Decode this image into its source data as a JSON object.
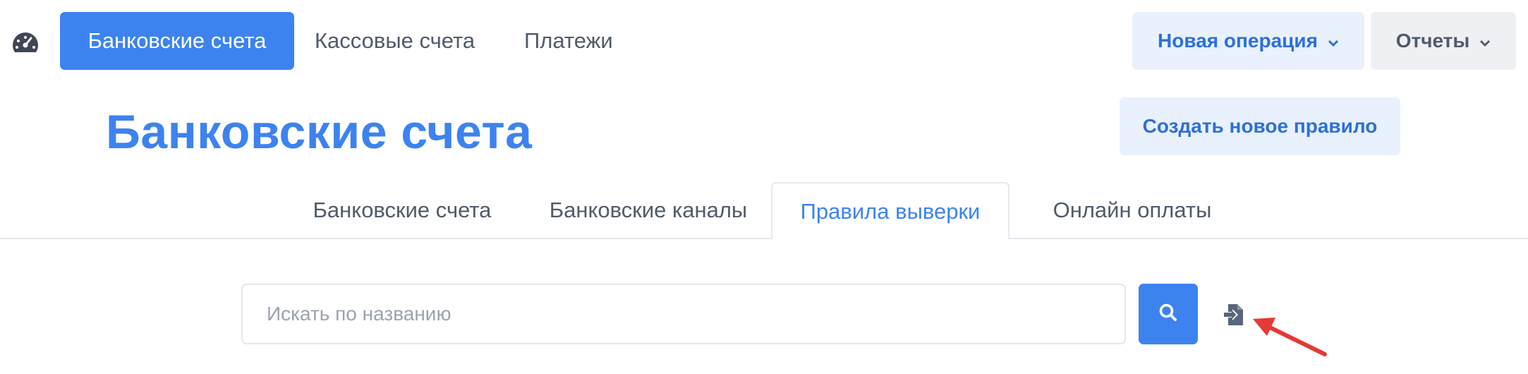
{
  "nav": {
    "dashboard_icon": "speedometer-icon",
    "items": [
      {
        "label": "Банковские счета",
        "active": true
      },
      {
        "label": "Кассовые счета",
        "active": false
      },
      {
        "label": "Платежи",
        "active": false
      }
    ],
    "new_operation_label": "Новая операция",
    "reports_label": "Отчеты"
  },
  "header": {
    "title": "Банковские счета",
    "create_rule_label": "Создать новое правило"
  },
  "tabs": [
    {
      "label": "Банковские счета",
      "active": false
    },
    {
      "label": "Банковские каналы",
      "active": false
    },
    {
      "label": "Правила выверки",
      "active": true
    },
    {
      "label": "Онлайн оплаты",
      "active": false
    }
  ],
  "search": {
    "placeholder": "Искать по названию",
    "value": ""
  },
  "icons": {
    "search": "magnifier-icon",
    "import": "file-import-icon",
    "annotation": "red-arrow-annotation"
  },
  "colors": {
    "primary": "#3d83f0",
    "primary_light": "#e8f1fd",
    "annotation": "#e53935"
  }
}
